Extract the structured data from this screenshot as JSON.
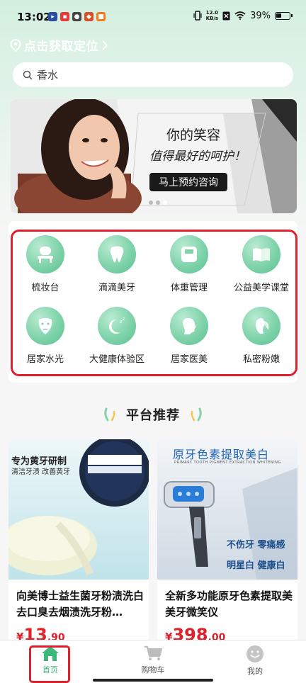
{
  "status_bar": {
    "time": "13:02",
    "net_speed": "12.0",
    "net_unit": "KB/s",
    "battery": "39%"
  },
  "header": {
    "location": "点击获取定位",
    "search_value": "香水"
  },
  "banner": {
    "title": "你的笑容",
    "subtitle": "值得最好的呵护！",
    "button": "马上预约咨询"
  },
  "categories": [
    {
      "label": "梳妆台",
      "icon": "vanity-icon"
    },
    {
      "label": "滴滴美牙",
      "icon": "tooth-icon"
    },
    {
      "label": "体重管理",
      "icon": "scale-icon"
    },
    {
      "label": "公益美学课堂",
      "icon": "book-icon"
    },
    {
      "label": "居家水光",
      "icon": "face-mask-icon"
    },
    {
      "label": "大健康体验区",
      "icon": "moon-sleep-icon"
    },
    {
      "label": "居家医美",
      "icon": "head-profile-icon"
    },
    {
      "label": "私密粉嫩",
      "icon": "leaf-woman-icon"
    }
  ],
  "section": {
    "title": "平台推荐"
  },
  "products": [
    {
      "name": "向美博士益生菌牙粉渍洗白去口臭去烟渍洗牙粉…",
      "currency": "¥",
      "price_int": "13",
      "price_dec": ".90",
      "tagline": "专为黄牙研制",
      "tagline2": "清洁牙渍 改善黄牙"
    },
    {
      "name": "全新多功能原牙色素提取美美牙微笑仪",
      "currency": "¥",
      "price_int": "398",
      "price_dec": ".00",
      "img_title": "原牙色素提取美白",
      "img_en": "PRIMARY TOOTH PIGMENT EXTRACTION WHITENING",
      "feature1": "不伤牙  零痛感",
      "feature2": "明星白  健康白"
    }
  ],
  "bottom_nav": [
    {
      "label": "首页",
      "icon": "home-icon",
      "active": true
    },
    {
      "label": "购物车",
      "icon": "cart-icon",
      "active": false
    },
    {
      "label": "我的",
      "icon": "smiley-icon",
      "active": false
    }
  ],
  "colors": {
    "accent": "#3cb878",
    "price": "#e0202a",
    "highlight_frame": "#e0202a"
  }
}
